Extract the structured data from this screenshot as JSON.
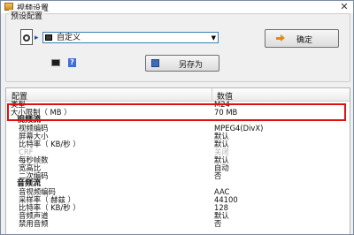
{
  "window": {
    "title": "视频设置",
    "close_glyph": "✕"
  },
  "preset": {
    "group_label": "预设配置",
    "combo_value": "自定义",
    "ok_label": "确定",
    "save_as_label": "另存为",
    "help_glyph": "?"
  },
  "grid": {
    "col_config": "配置",
    "col_value": "数值",
    "rows": [
      {
        "key": "类型",
        "value": "M24"
      },
      {
        "key": "大小限制（ MB ）",
        "value": "70 MB"
      },
      {
        "key": "视频流",
        "value": ""
      },
      {
        "key": "视频编码",
        "value": "MPEG4(DivX)"
      },
      {
        "key": "屏幕大小",
        "value": "默认"
      },
      {
        "key": "比特率（ KB/秒 ）",
        "value": "默认"
      },
      {
        "key": "CRF",
        "value": "关闭"
      },
      {
        "key": "每秒帧数",
        "value": "默认"
      },
      {
        "key": "宽高比",
        "value": "自动"
      },
      {
        "key": "二次编码",
        "value": "否"
      },
      {
        "key": "音频流",
        "value": ""
      },
      {
        "key": "音视频编码",
        "value": "AAC"
      },
      {
        "key": "采样率（ 赫兹 ）",
        "value": "44100"
      },
      {
        "key": "比特率（ KB/秒 ）",
        "value": "128"
      },
      {
        "key": "音频声道",
        "value": "默认"
      },
      {
        "key": "禁用音频",
        "value": "否"
      }
    ]
  },
  "colors": {
    "highlight": "#e01010",
    "combo_border": "#3c7fb1",
    "ok_arrow": "#e08b16"
  }
}
